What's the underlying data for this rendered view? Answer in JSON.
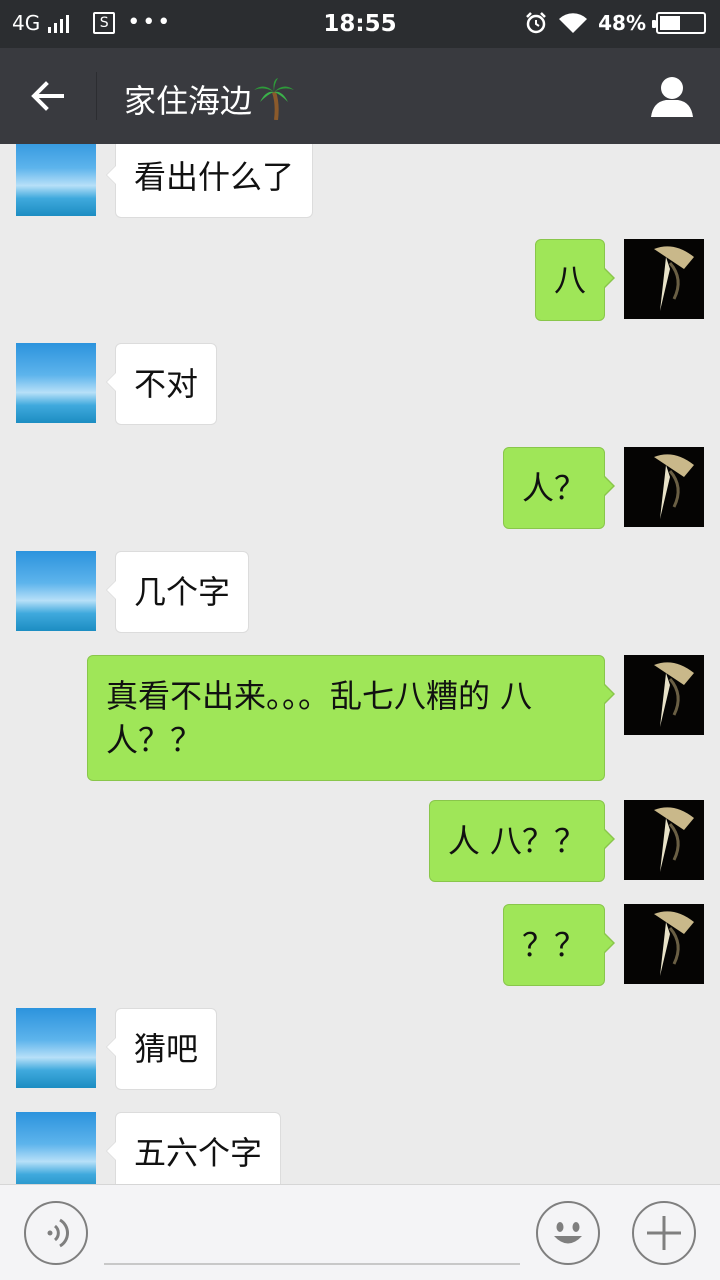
{
  "status_bar": {
    "network": "4G",
    "time": "18:55",
    "battery": "48%",
    "battery_level": 0.48,
    "icons": [
      "signal-icon",
      "sim-icon",
      "more-dots-icon",
      "alarm-icon",
      "wifi-icon",
      "battery-icon"
    ]
  },
  "header": {
    "title": "家住海边",
    "title_emoji": "palm-tree-icon",
    "back_icon": "back-arrow-icon",
    "profile_icon": "person-icon",
    "background": "#393a3f"
  },
  "messages": [
    {
      "side": "left",
      "avatar": "sky-avatar",
      "text": "看出什么了"
    },
    {
      "side": "right",
      "avatar": "dark-figure-avatar",
      "text": "八"
    },
    {
      "side": "left",
      "avatar": "sky-avatar",
      "text": "不对"
    },
    {
      "side": "right",
      "avatar": "dark-figure-avatar",
      "text": "人？"
    },
    {
      "side": "left",
      "avatar": "sky-avatar",
      "text": "几个字"
    },
    {
      "side": "right",
      "avatar": "dark-figure-avatar",
      "text": "真看不出来。。。乱七八糟的 八人？？"
    },
    {
      "side": "right",
      "avatar": "dark-figure-avatar",
      "text": "人 八？？"
    },
    {
      "side": "right",
      "avatar": "dark-figure-avatar",
      "text": "？？"
    },
    {
      "side": "left",
      "avatar": "sky-avatar",
      "text": "猜吧"
    },
    {
      "side": "left",
      "avatar": "sky-avatar",
      "text": "五六个字"
    }
  ],
  "input_bar": {
    "placeholder": "",
    "icons": [
      "voice-icon",
      "emoji-icon",
      "plus-icon"
    ]
  },
  "colors": {
    "chat_background": "#ebebeb",
    "sent_bubble": "#9fe658",
    "received_bubble": "#ffffff"
  }
}
